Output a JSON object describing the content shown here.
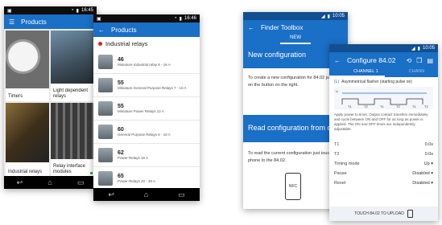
{
  "phone1": {
    "status_time": "16:45",
    "title": "Products",
    "tiles": [
      {
        "label": "Timers"
      },
      {
        "label": "Light dependent relays"
      },
      {
        "label": "Industrial relays"
      },
      {
        "label": "Relay interface modules"
      }
    ]
  },
  "phone2": {
    "status_time": "16:46",
    "title": "Products",
    "section": "Industrial relays",
    "items": [
      {
        "num": "46",
        "desc": "Miniature Industrial relay 8 - 16 A"
      },
      {
        "num": "55",
        "desc": "Miniature General Purpose Relays 7 - 10 A"
      },
      {
        "num": "55",
        "desc": "Miniature Power Relays 12 A"
      },
      {
        "num": "60",
        "desc": "General Purpose Relays 6 - 10 A"
      },
      {
        "num": "62",
        "desc": "Power Relays 16 A"
      },
      {
        "num": "65",
        "desc": "Power Relays 20 - 30 A"
      }
    ]
  },
  "phone3": {
    "status_time": "10:05",
    "title": "Finder Toolbox",
    "tab": "NEW",
    "new_config_title": "New configuration",
    "new_config_text": "To create a new configuration for 84.02 just click on the button on the right.",
    "read_config_title": "Read configuration from dev",
    "read_config_text": "To read the current configuration just touch your phone to the 84.02.",
    "nfc_label": "NFC"
  },
  "phone4": {
    "status_time": "10:05",
    "title": "Configure 84.02",
    "tab_active": "CHANNEL 1",
    "tab_inactive": "CHANN",
    "mode_code": "(L)",
    "mode_label": "Asymmetrical flasher (starting pulse on)",
    "description": "Apply power to timer. Output contact transfers immediately and cycle between ON and OFF for as long as power is applied. The ON and OFF times are independently adjustable.",
    "timing_labels": [
      "U",
      "T1",
      "T2",
      "T1",
      "T2",
      "T1",
      "T2"
    ],
    "fields": [
      {
        "label": "T1",
        "value": "0.0s"
      },
      {
        "label": "T2",
        "value": "0.0s"
      },
      {
        "label": "Timing mode",
        "value": "Up"
      },
      {
        "label": "Pause",
        "value": "Disabled"
      },
      {
        "label": "Reset",
        "value": "Disabled"
      }
    ],
    "bottom_text": "TOUCH 84.02 TO UPLOAD"
  }
}
